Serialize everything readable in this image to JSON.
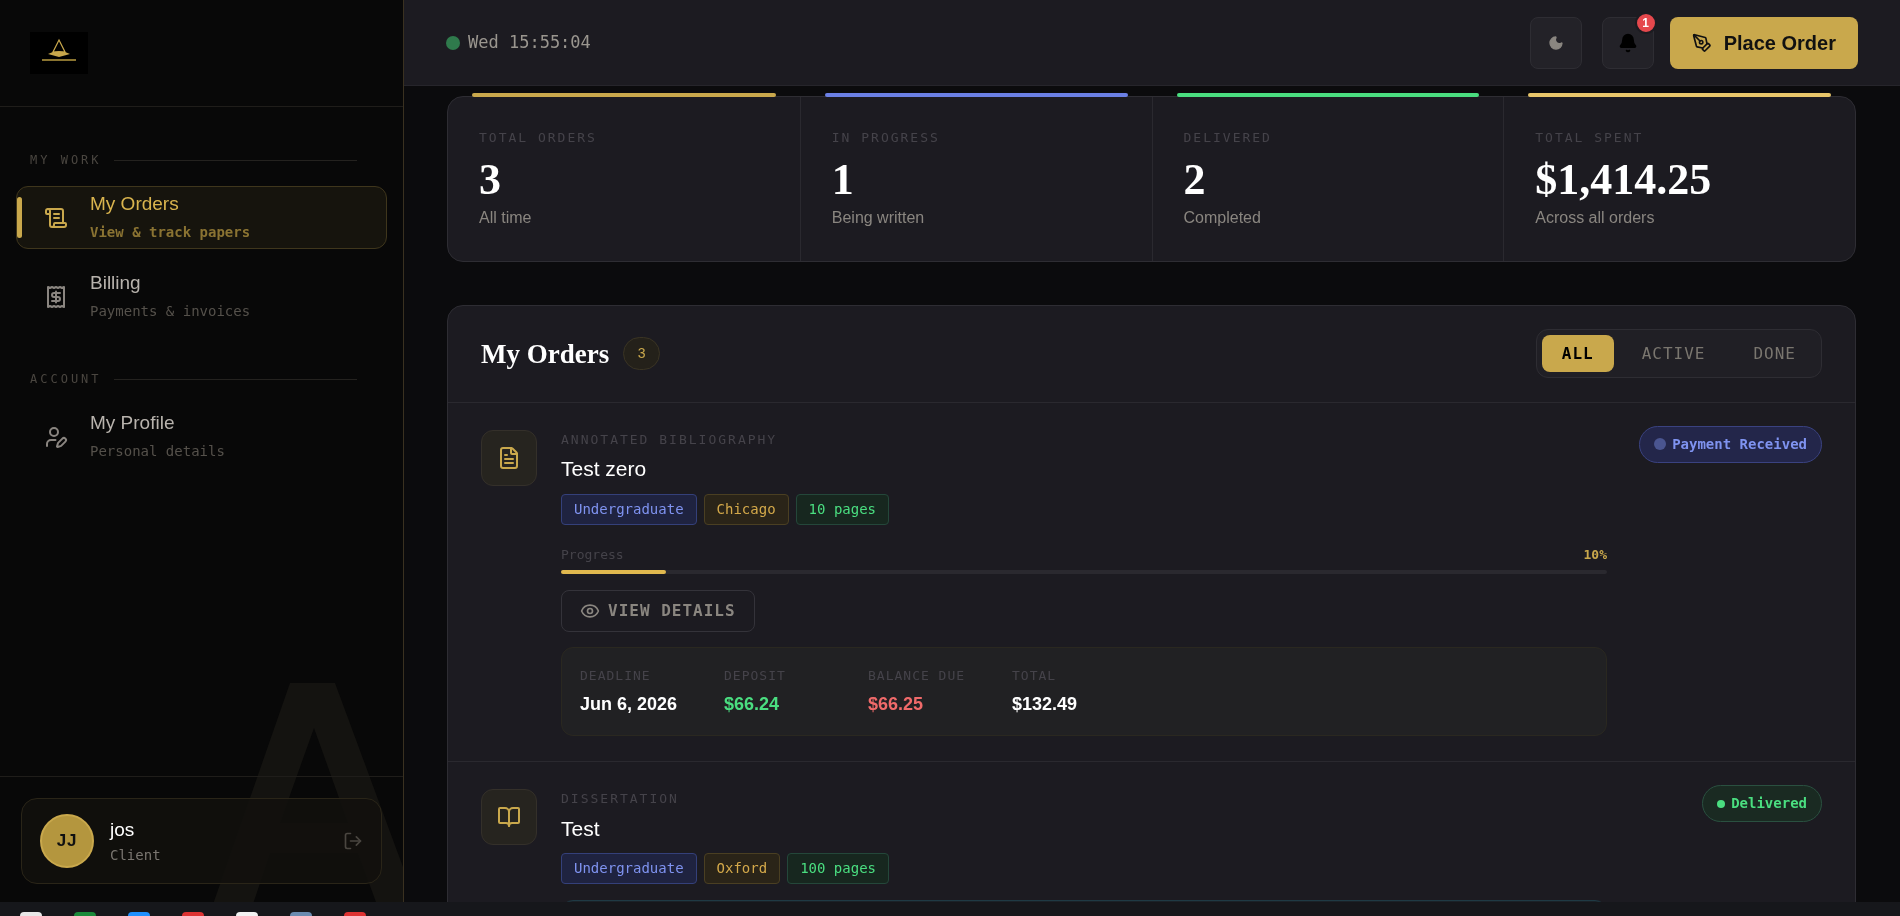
{
  "sidebar": {
    "sections": [
      {
        "title": "MY WORK",
        "items": [
          {
            "label": "My Orders",
            "sub": "View & track papers",
            "kind": "orders",
            "selected": true
          },
          {
            "label": "Billing",
            "sub": "Payments & invoices",
            "kind": "billing",
            "selected": false
          }
        ]
      },
      {
        "title": "ACCOUNT",
        "items": [
          {
            "label": "My Profile",
            "sub": "Personal details",
            "kind": "profile",
            "selected": false
          }
        ]
      }
    ],
    "user": {
      "initials": "JJ",
      "name": "jos",
      "role": "Client"
    }
  },
  "header": {
    "clock": "Wed 15:55:04",
    "notifications": "1",
    "cta": "Place Order"
  },
  "stats": [
    {
      "label": "TOTAL ORDERS",
      "value": "3",
      "note": "All time",
      "color": "#c9a84c"
    },
    {
      "label": "IN PROGRESS",
      "value": "1",
      "note": "Being written",
      "color": "#6b80e6"
    },
    {
      "label": "DELIVERED",
      "value": "2",
      "note": "Completed",
      "color": "#4ade80"
    },
    {
      "label": "TOTAL SPENT",
      "value": "$1,414.25",
      "note": "Across all orders",
      "color": "#e8c66a"
    }
  ],
  "orders_panel": {
    "title": "My Orders",
    "count": "3",
    "tabs": [
      {
        "label": "ALL",
        "selected": true
      },
      {
        "label": "ACTIVE",
        "selected": false
      },
      {
        "label": "DONE",
        "selected": false
      }
    ]
  },
  "orders": [
    {
      "category": "ANNOTATED BIBLIOGRAPHY",
      "title": "Test zero",
      "kind": "document",
      "status": {
        "label": "Payment Received",
        "kind": "payment"
      },
      "tags": [
        {
          "label": "Undergraduate",
          "kind": "level"
        },
        {
          "label": "Chicago",
          "kind": "style"
        },
        {
          "label": "10 pages",
          "kind": "pages"
        }
      ],
      "progress": {
        "label": "Progress",
        "reading": "10%",
        "level": 0.1
      },
      "action": "VIEW DETAILS",
      "details": [
        {
          "label": "DEADLINE",
          "value": "Jun 6, 2026",
          "kind": "plain"
        },
        {
          "label": "DEPOSIT",
          "value": "$66.24",
          "kind": "paid"
        },
        {
          "label": "BALANCE DUE",
          "value": "$66.25",
          "kind": "due"
        },
        {
          "label": "TOTAL",
          "value": "$132.49",
          "kind": "plain"
        }
      ]
    },
    {
      "category": "DISSERTATION",
      "title": "Test",
      "kind": "book",
      "status": {
        "label": "Delivered",
        "kind": "delivered"
      },
      "tags": [
        {
          "label": "Undergraduate",
          "kind": "level"
        },
        {
          "label": "Oxford",
          "kind": "style"
        },
        {
          "label": "100 pages",
          "kind": "pages"
        }
      ]
    }
  ]
}
